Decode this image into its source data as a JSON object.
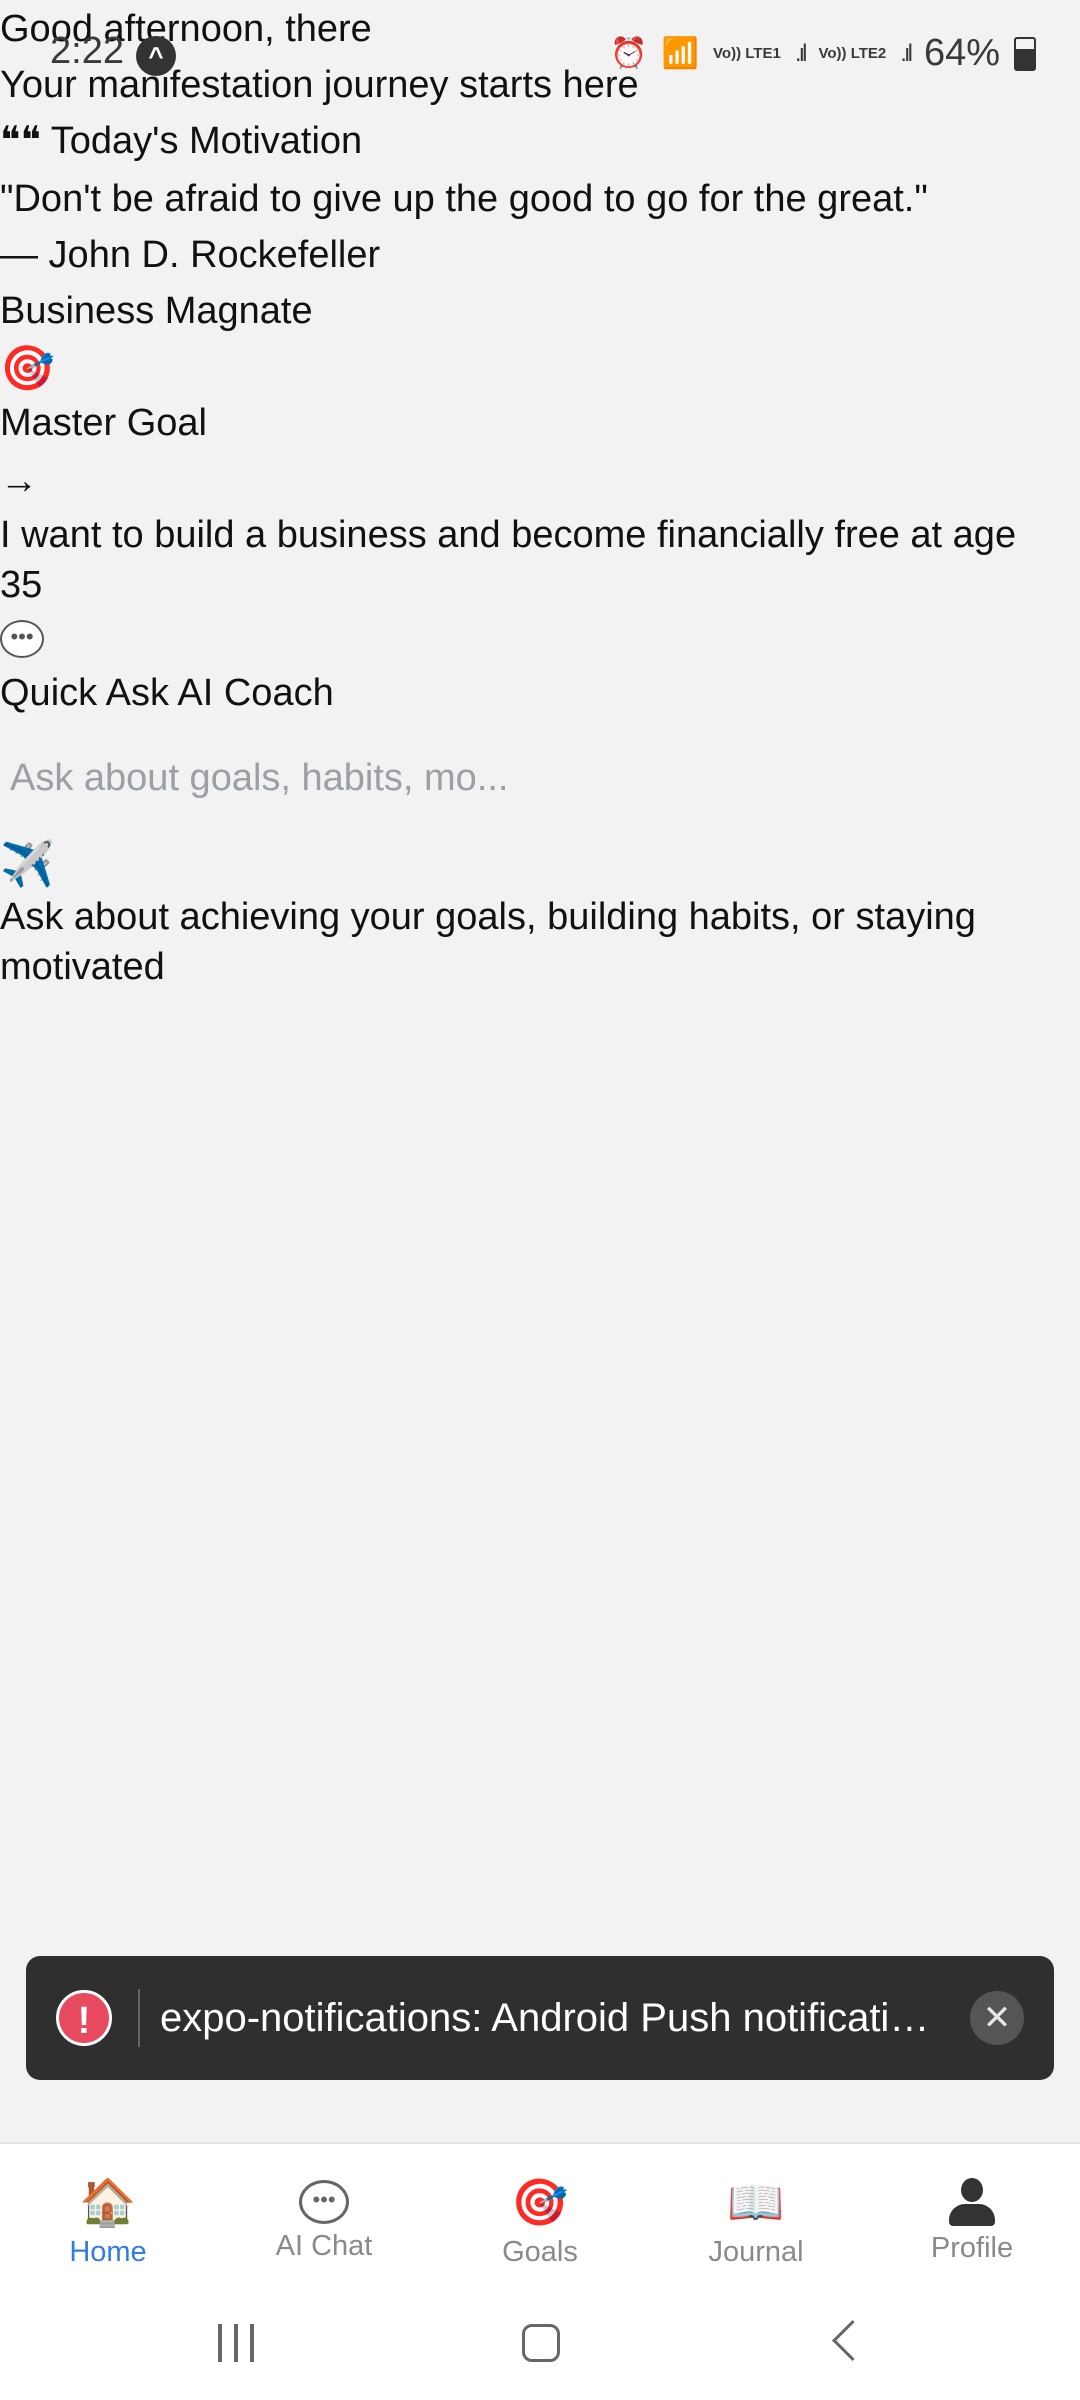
{
  "status_bar": {
    "time": "2:22",
    "battery": "64%",
    "network_1": "Vo)) LTE1",
    "network_2": "Vo)) LTE2"
  },
  "home": {
    "greeting": "Good afternoon, there",
    "subtitle": "Your manifestation journey starts here",
    "motivation_icon": "❝❝",
    "motivation_title": "Today's Motivation",
    "quote": "\"Don't be afraid to give up the good to go for the great.\"",
    "author": "— John D. Rockefeller",
    "author_title": "Business Magnate",
    "goal_icon": "🎯",
    "goal_label": "Master Goal",
    "arrow": "→",
    "goal_text": "I want to build a business and become financially free at age 35",
    "coach_label": "Quick Ask AI Coach",
    "ask_placeholder": "Ask about goals, habits, mo...",
    "send_icon": "✈️",
    "hint": "Ask about achieving your goals, building habits, or staying motivated"
  },
  "toast": {
    "icon": "!",
    "message": "expo-notifications: Android Push notificati…",
    "close": "✕"
  },
  "tabs": [
    {
      "label": "Home",
      "icon": "🏠",
      "active": true
    },
    {
      "label": "AI Chat",
      "icon": "chat-bubble"
    },
    {
      "label": "Goals",
      "icon": "🎯"
    },
    {
      "label": "Journal",
      "icon": "📖"
    },
    {
      "label": "Profile",
      "icon": "person"
    }
  ],
  "colors": {
    "background": "#f2f2f2",
    "accent": "#2f7de0",
    "toast_bg": "#2f2f2f",
    "error": "#e84a5f"
  }
}
